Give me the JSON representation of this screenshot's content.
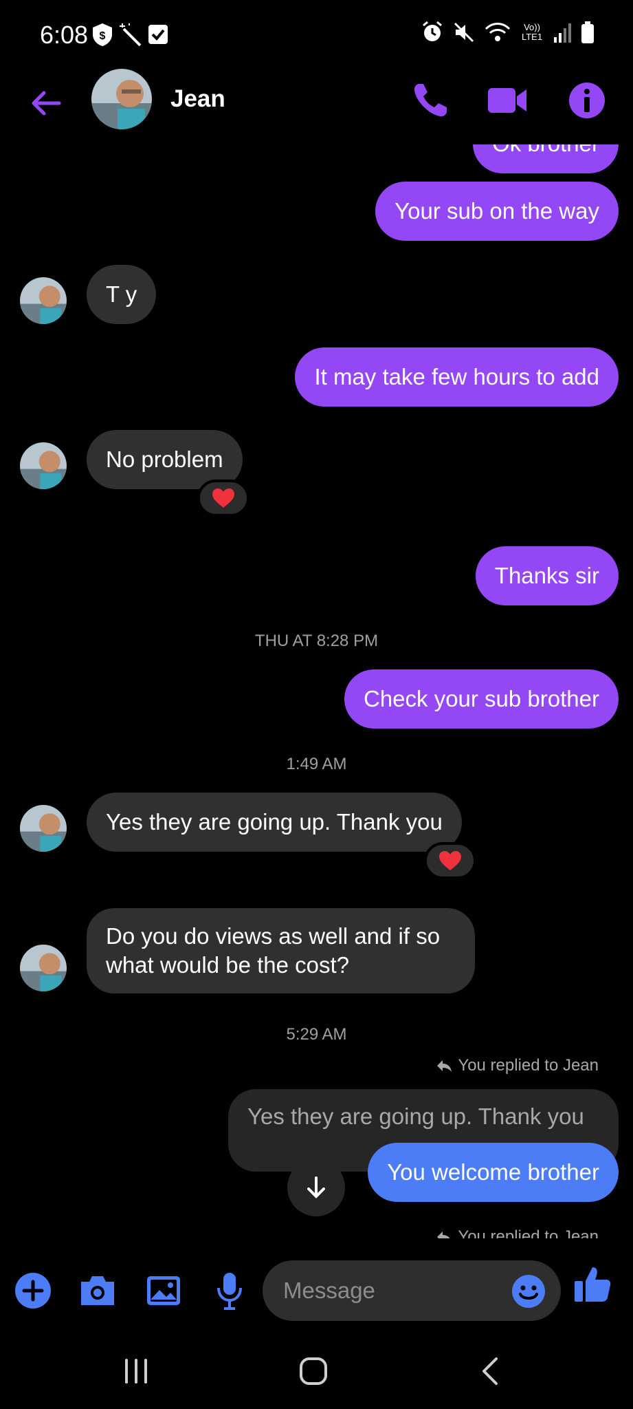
{
  "status_bar": {
    "time": "6:08",
    "network_label": "Vo)) LTE1"
  },
  "header": {
    "contact_name": "Jean"
  },
  "messages": [
    {
      "text": "Ok brother"
    },
    {
      "text": "Your sub on the way"
    },
    {
      "text": "T y"
    },
    {
      "text": "It may take few hours to add"
    },
    {
      "text": "No problem"
    },
    {
      "text": "Thanks sir"
    },
    {
      "text": "Check your sub brother"
    },
    {
      "text": "Yes they are going up. Thank you"
    },
    {
      "text": "Do you do views as well and if so what would be the cost?"
    },
    {
      "text": "Yes they are going up. Thank you"
    },
    {
      "text": "You welcome brother"
    }
  ],
  "timestamps": [
    "THU AT 8:28 PM",
    "1:49 AM",
    "5:29 AM"
  ],
  "reply_notes": [
    "You replied to Jean",
    "You replied to Jean"
  ],
  "composer": {
    "placeholder": "Message"
  },
  "colors": {
    "accent": "#9447f5",
    "blue": "#4c7cf6",
    "received": "#303030",
    "background": "#000000"
  }
}
